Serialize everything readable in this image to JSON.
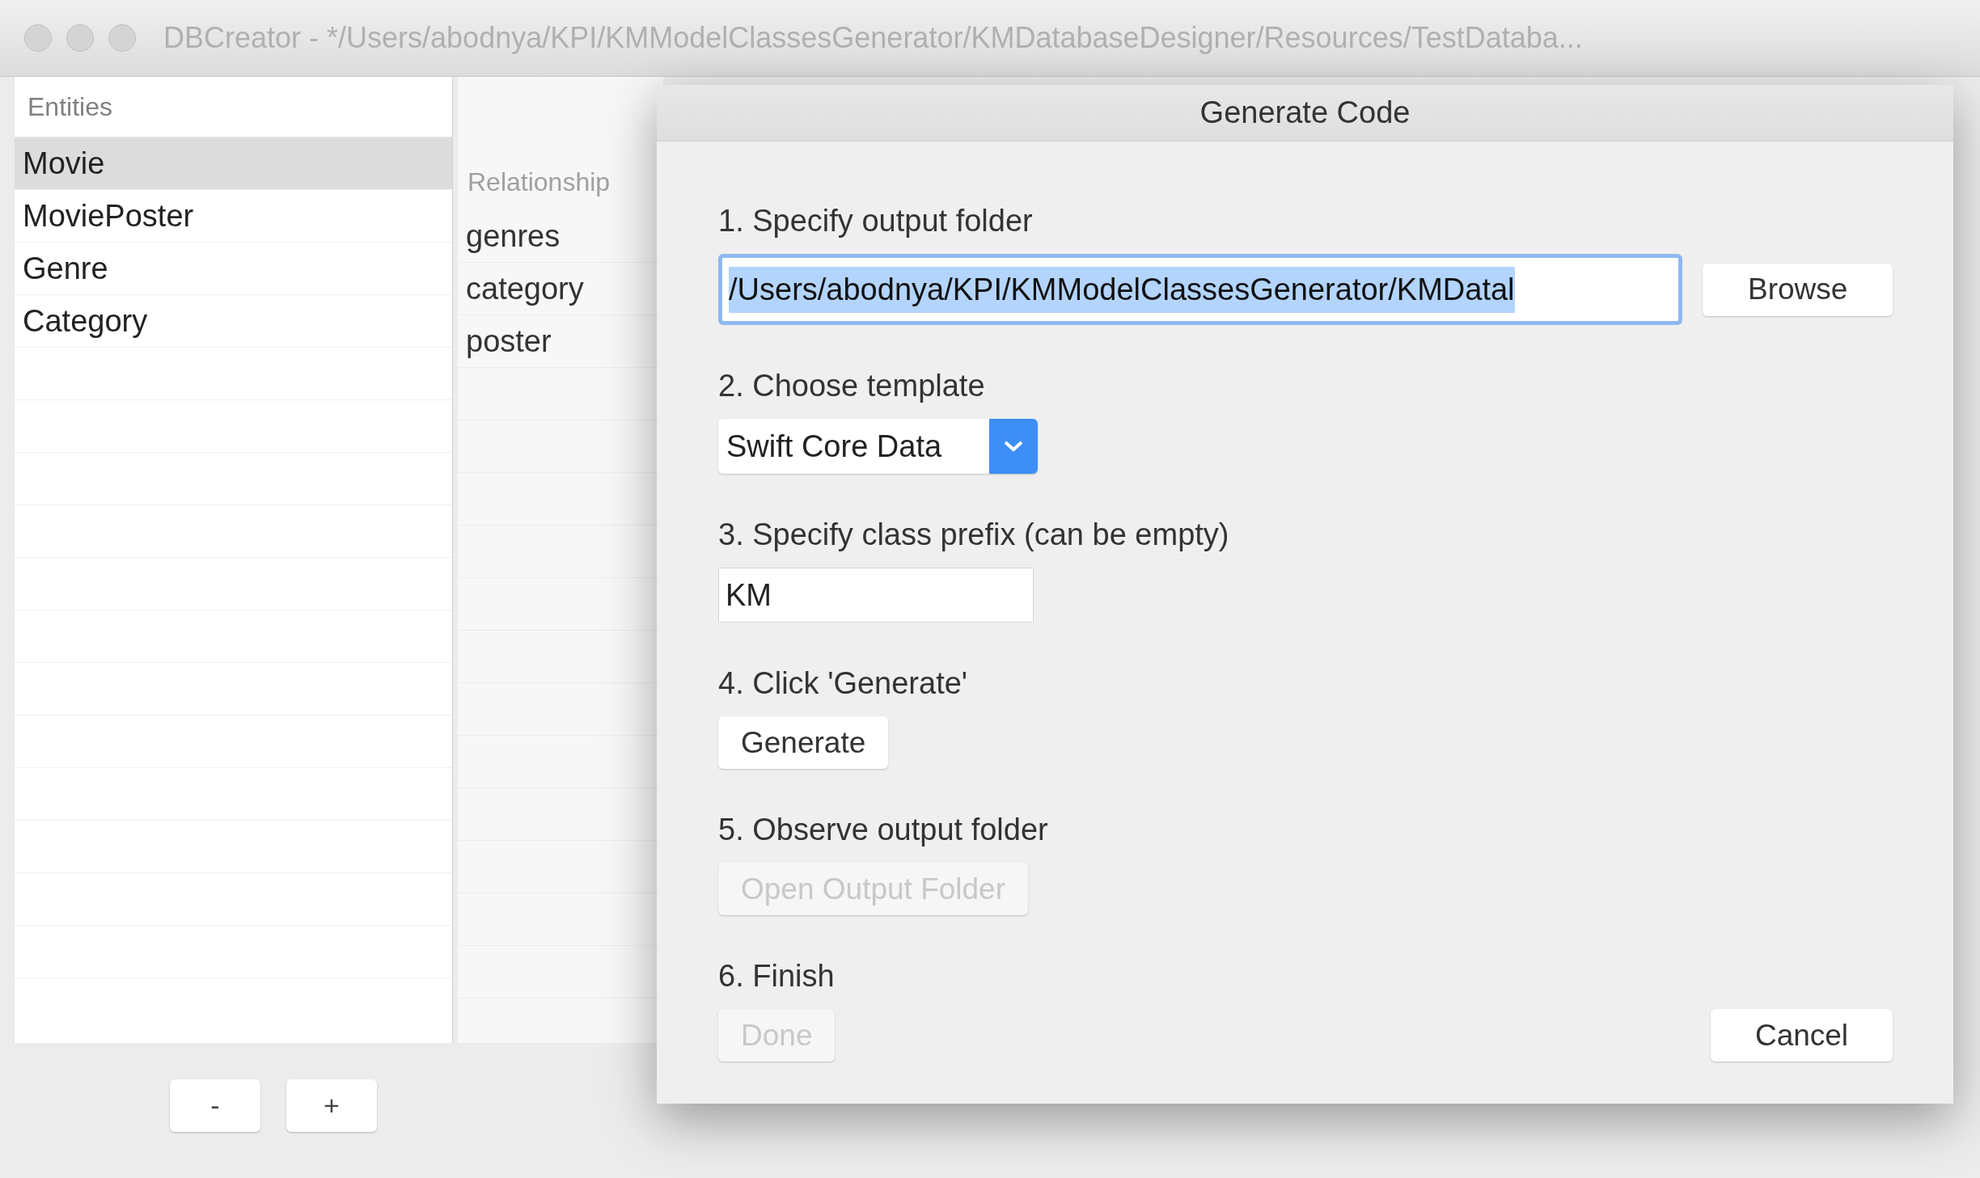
{
  "window": {
    "title": "DBCreator - */Users/abodnya/KPI/KMModelClassesGenerator/KMDatabaseDesigner/Resources/TestDataba..."
  },
  "entities": {
    "header": "Entities",
    "items": [
      {
        "label": "Movie",
        "selected": true
      },
      {
        "label": "MoviePoster",
        "selected": false
      },
      {
        "label": "Genre",
        "selected": false
      },
      {
        "label": "Category",
        "selected": false
      }
    ],
    "buttons": [
      "-",
      "+"
    ]
  },
  "relationships": {
    "header": "Relationship",
    "items": [
      "genres",
      "category",
      "poster"
    ]
  },
  "dialog": {
    "title": "Generate Code",
    "steps": [
      {
        "label": "1. Specify output folder",
        "kind": "path",
        "value": "/Users/abodnya/KPI/KMModelClassesGenerator/KMDatal",
        "text_selected": true,
        "button": "Browse"
      },
      {
        "label": "2. Choose template",
        "kind": "dropdown",
        "value": "Swift Core Data"
      },
      {
        "label": "3. Specify class prefix (can be empty)",
        "kind": "text",
        "value": "KM"
      },
      {
        "label": "4. Click 'Generate'",
        "kind": "button",
        "button": "Generate",
        "disabled": false
      },
      {
        "label": "5. Observe output folder",
        "kind": "button",
        "button": "Open Output Folder",
        "disabled": true
      },
      {
        "label": "6. Finish",
        "kind": "finish",
        "button": "Done",
        "disabled": true,
        "cancel": "Cancel"
      }
    ]
  }
}
